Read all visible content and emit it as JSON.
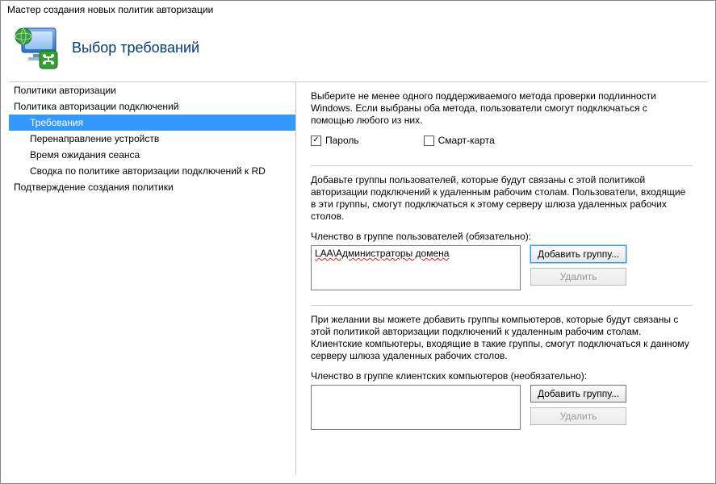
{
  "window": {
    "title": "Мастер создания новых политик авторизации"
  },
  "header": {
    "title": "Выбор требований"
  },
  "nav": {
    "items": [
      {
        "label": "Политики авторизации",
        "sub": false,
        "active": false
      },
      {
        "label": "Политика авторизации подключений",
        "sub": false,
        "active": false
      },
      {
        "label": "Требования",
        "sub": true,
        "active": true
      },
      {
        "label": "Перенаправление устройств",
        "sub": true,
        "active": false
      },
      {
        "label": "Время ожидания сеанса",
        "sub": true,
        "active": false
      },
      {
        "label": "Сводка по политике авторизации подключений к RD",
        "sub": true,
        "active": false
      },
      {
        "label": "Подтверждение создания политики",
        "sub": false,
        "active": false
      }
    ]
  },
  "main": {
    "auth_intro": "Выберите не менее одного поддерживаемого метода проверки подлинности Windows. Если выбраны оба метода, пользователи смогут подключаться с помощью любого из них.",
    "cb_password": {
      "label": "Пароль",
      "checked": true
    },
    "cb_smartcard": {
      "label": "Смарт-карта",
      "checked": false
    },
    "user_groups": {
      "intro": "Добавьте группы пользователей, которые будут связаны с этой политикой авторизации подключений к удаленным рабочим столам. Пользователи, входящие в эти группы, смогут подключаться к этому серверу шлюза удаленных рабочих столов.",
      "label": "Членство в группе пользователей (обязательно):",
      "items": [
        "LAA\\Администраторы домена"
      ],
      "add_btn": "Добавить группу...",
      "remove_btn": "Удалить"
    },
    "computer_groups": {
      "intro": "При желании вы можете добавить группы компьютеров, которые будут связаны с этой политикой авторизации подключений к удаленным рабочим столам. Клиентские компьютеры, входящие в такие группы, смогут подключаться к данному серверу шлюза удаленных рабочих столов.",
      "label": "Членство в группе клиентских компьютеров (необязательно):",
      "items": [],
      "add_btn": "Добавить группу...",
      "remove_btn": "Удалить"
    }
  }
}
